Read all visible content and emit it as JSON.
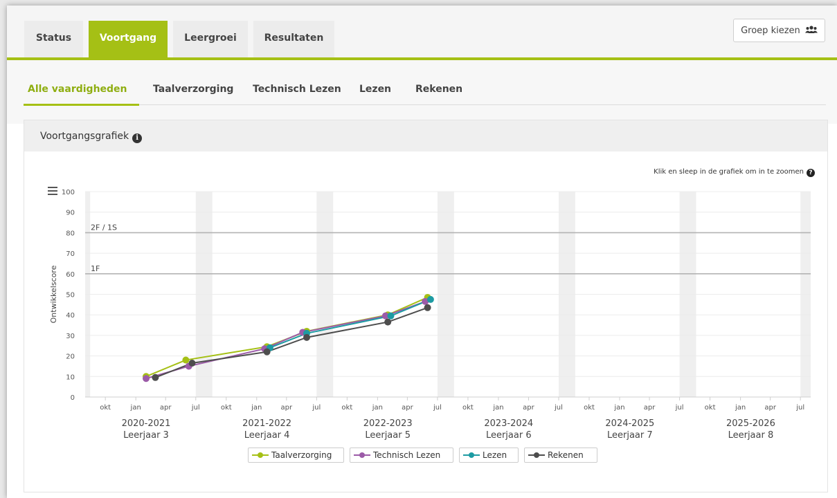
{
  "tabs": [
    {
      "label": "Status",
      "active": false
    },
    {
      "label": "Voortgang",
      "active": true
    },
    {
      "label": "Leergroei",
      "active": false
    },
    {
      "label": "Resultaten",
      "active": false
    }
  ],
  "group_button": {
    "label": "Groep kiezen",
    "icon": "users-icon"
  },
  "subtabs": [
    {
      "label": "Alle vaardigheden",
      "active": true
    },
    {
      "label": "Taalverzorging",
      "active": false
    },
    {
      "label": "Technisch Lezen",
      "active": false
    },
    {
      "label": "Lezen",
      "active": false
    },
    {
      "label": "Rekenen",
      "active": false
    }
  ],
  "panel": {
    "title": "Voortgangsgrafiek",
    "info_icon": "info-icon"
  },
  "hint": {
    "text": "Klik en sleep in de grafiek om in te zoomen",
    "icon": "help-icon"
  },
  "chart_data": {
    "type": "line",
    "ylabel": "Ontwikkelscore",
    "ylim": [
      0,
      100
    ],
    "yticks": [
      0,
      10,
      20,
      30,
      40,
      50,
      60,
      70,
      80,
      90,
      100
    ],
    "xlim": [
      "2020-08-01",
      "2026-08-01"
    ],
    "month_ticks": [
      "okt",
      "jan",
      "apr",
      "jul"
    ],
    "school_years": [
      {
        "year": "2020-2021",
        "grade": "Leerjaar 3"
      },
      {
        "year": "2021-2022",
        "grade": "Leerjaar 4"
      },
      {
        "year": "2022-2023",
        "grade": "Leerjaar 5"
      },
      {
        "year": "2023-2024",
        "grade": "Leerjaar 6"
      },
      {
        "year": "2024-2025",
        "grade": "Leerjaar 7"
      },
      {
        "year": "2025-2026",
        "grade": "Leerjaar 8"
      }
    ],
    "reference_lines": [
      {
        "label": "2F / 1S",
        "value": 80
      },
      {
        "label": "1F",
        "value": 60
      }
    ],
    "series": [
      {
        "name": "Taalverzorging",
        "color": "#a5c015",
        "points": [
          [
            "2021-02-01",
            10
          ],
          [
            "2021-06-01",
            18
          ],
          [
            "2022-02-01",
            24.5
          ],
          [
            "2022-06-01",
            32
          ],
          [
            "2023-02-01",
            40
          ],
          [
            "2023-06-01",
            48.5
          ]
        ]
      },
      {
        "name": "Technisch Lezen",
        "color": "#9c5ba8",
        "points": [
          [
            "2021-02-01",
            9
          ],
          [
            "2021-06-10",
            15
          ],
          [
            "2022-01-25",
            23.5
          ],
          [
            "2022-05-20",
            31.5
          ],
          [
            "2023-01-25",
            39.5
          ],
          [
            "2023-05-25",
            46.5
          ]
        ]
      },
      {
        "name": "Lezen",
        "color": "#1d9ba3",
        "points": [
          [
            "2022-02-10",
            24
          ],
          [
            "2022-06-01",
            31
          ],
          [
            "2023-02-10",
            39.5
          ],
          [
            "2023-06-10",
            47.5
          ]
        ]
      },
      {
        "name": "Rekenen",
        "color": "#4d4d4d",
        "points": [
          [
            "2021-03-01",
            9.5
          ],
          [
            "2021-06-20",
            16.5
          ],
          [
            "2022-02-01",
            22
          ],
          [
            "2022-06-01",
            29
          ],
          [
            "2023-02-01",
            36.5
          ],
          [
            "2023-06-01",
            43.5
          ]
        ]
      }
    ],
    "legend_position": "bottom",
    "grid": true
  }
}
